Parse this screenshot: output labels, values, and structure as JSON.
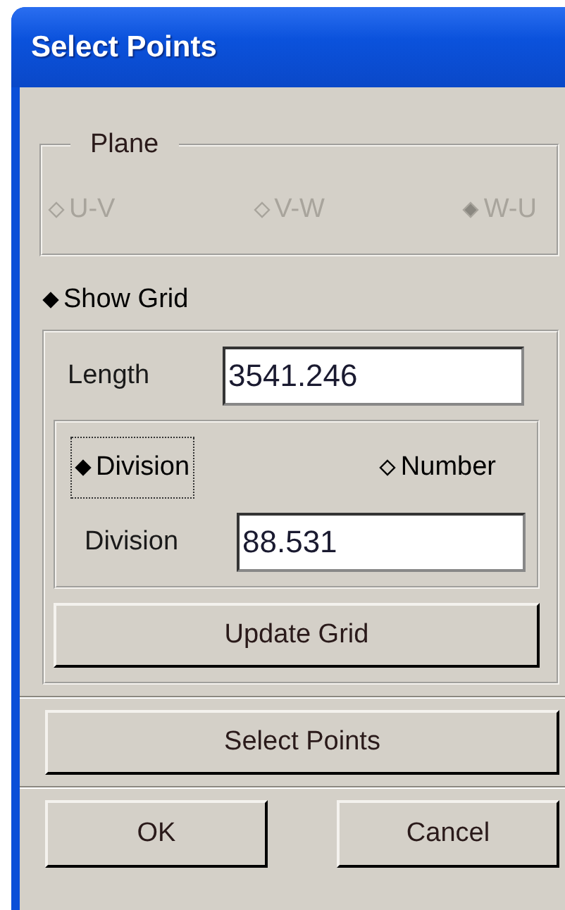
{
  "window": {
    "title": "Select Points"
  },
  "plane": {
    "label": "Plane",
    "disabled": true,
    "options": [
      {
        "label": "U-V",
        "selected": false
      },
      {
        "label": "V-W",
        "selected": false
      },
      {
        "label": "W-U",
        "selected": true
      }
    ]
  },
  "show_grid": {
    "label": "Show Grid",
    "on": true
  },
  "length": {
    "label": "Length",
    "value": "3541.246"
  },
  "mode_options": [
    {
      "label": "Division",
      "selected": true,
      "focused": true
    },
    {
      "label": "Number",
      "selected": false,
      "focused": false
    }
  ],
  "division": {
    "label": "Division",
    "value": "88.531"
  },
  "update_button": "Update Grid",
  "select_button": "Select Points",
  "footer_buttons": [
    "OK",
    "Cancel"
  ]
}
